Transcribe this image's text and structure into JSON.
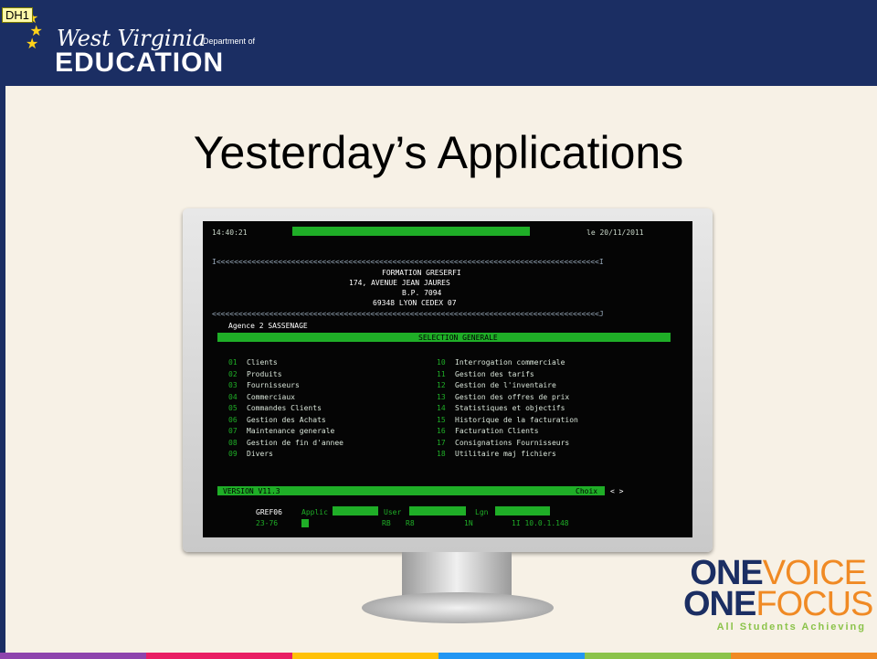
{
  "comment_tag": "DH1",
  "logo": {
    "script": "West Virginia",
    "dept": "Department of",
    "edu": "EDUCATION"
  },
  "slide_title": "Yesterday’s Applications",
  "terminal": {
    "time": "14:40:21",
    "date": "le 20/11/2011",
    "company_lines": [
      "FORMATION GRESERFI",
      "174, AVENUE JEAN JAURES",
      "B.P. 7094",
      "69348 LYON CEDEX 07"
    ],
    "agency": "Agence 2 SASSENAGE",
    "menu_bar": "SELECTION GENERALE",
    "left_menu": [
      {
        "num": "01",
        "label": "Clients"
      },
      {
        "num": "02",
        "label": "Produits"
      },
      {
        "num": "03",
        "label": "Fournisseurs"
      },
      {
        "num": "04",
        "label": "Commerciaux"
      },
      {
        "num": "05",
        "label": "Commandes Clients"
      },
      {
        "num": "06",
        "label": "Gestion des Achats"
      },
      {
        "num": "07",
        "label": "Maintenance generale"
      },
      {
        "num": "08",
        "label": "Gestion de fin d'annee"
      },
      {
        "num": "09",
        "label": "Divers"
      }
    ],
    "right_menu": [
      {
        "num": "10",
        "label": "Interrogation commerciale"
      },
      {
        "num": "11",
        "label": "Gestion des tarifs"
      },
      {
        "num": "12",
        "label": "Gestion de l'inventaire"
      },
      {
        "num": "13",
        "label": "Gestion des offres de prix"
      },
      {
        "num": "14",
        "label": "Statistiques et objectifs"
      },
      {
        "num": "15",
        "label": "Historique de la facturation"
      },
      {
        "num": "16",
        "label": "Facturation Clients"
      },
      {
        "num": "17",
        "label": "Consignations Fournisseurs"
      },
      {
        "num": "18",
        "label": "Utilitaire maj fichiers"
      }
    ],
    "version": "VERSION V11.3",
    "choix": "Choix",
    "nav": "< >",
    "footer_prog": "GREF06",
    "footer_applic_label": "Applic",
    "footer_user_label": "User",
    "footer_lgn_label": "Lgn",
    "footer_row2": [
      "23-76",
      "RB",
      "R8",
      "1N",
      "1I 10.0.1.148"
    ]
  },
  "brand": {
    "line1_bold": "ONE",
    "line1_light": "VOICE",
    "line2_bold": "ONE",
    "line2_light": "FOCUS",
    "tagline": "All Students Achieving"
  },
  "colors": {
    "navy": "#1b2e63",
    "orange": "#f08a24",
    "green": "#8bc34a",
    "terminal_green": "#1fae27"
  }
}
